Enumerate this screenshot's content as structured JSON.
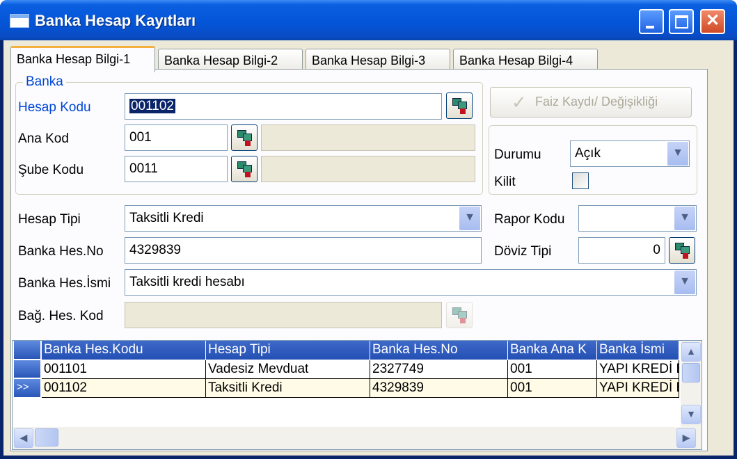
{
  "window": {
    "title": "Banka Hesap Kayıtları"
  },
  "tabs": [
    {
      "label": "Banka Hesap Bilgi-1"
    },
    {
      "label": "Banka Hesap Bilgi-2"
    },
    {
      "label": "Banka Hesap Bilgi-3"
    },
    {
      "label": "Banka Hesap Bilgi-4"
    }
  ],
  "banka_group": {
    "legend": "Banka"
  },
  "fields": {
    "hesap_kodu": {
      "label": "Hesap Kodu",
      "value": "001102"
    },
    "ana_kod": {
      "label": "Ana Kod",
      "value": "001",
      "desc": ""
    },
    "sube_kodu": {
      "label": "Şube Kodu",
      "value": "0011",
      "desc": ""
    },
    "hesap_tipi": {
      "label": "Hesap Tipi",
      "value": "Taksitli Kredi"
    },
    "banka_hes_no": {
      "label": "Banka Hes.No",
      "value": "4329839"
    },
    "banka_hes_ismi": {
      "label": "Banka Hes.İsmi",
      "value": "Taksitli kredi hesabı"
    },
    "bag_hes_kod": {
      "label": "Bağ. Hes. Kod",
      "value": ""
    },
    "durumu": {
      "label": "Durumu",
      "value": "Açık"
    },
    "kilit": {
      "label": "Kilit",
      "checked": false
    },
    "rapor_kodu": {
      "label": "Rapor Kodu",
      "value": ""
    },
    "doviz_tipi": {
      "label": "Döviz Tipi",
      "value": "0"
    }
  },
  "faiz_button": {
    "label": "Faiz Kaydı/ Değişikliği"
  },
  "grid": {
    "columns": [
      "Banka Hes.Kodu",
      "Hesap Tipi",
      "Banka Hes.No",
      "Banka Ana K",
      "Banka İsmi"
    ],
    "rows": [
      [
        "001101",
        "Vadesiz Mevduat",
        "2327749",
        "001",
        "YAPI KREDİ BA"
      ],
      [
        "001102",
        "Taksitli Kredi",
        "4329839",
        "001",
        "YAPI KREDİ BA"
      ]
    ],
    "current_row_marker": ">>"
  },
  "colors": {
    "title_bar": "#0454d6",
    "grid_header": "#2450b4",
    "selected_row": "#fffbe6",
    "label_blue": "#0046d5"
  }
}
